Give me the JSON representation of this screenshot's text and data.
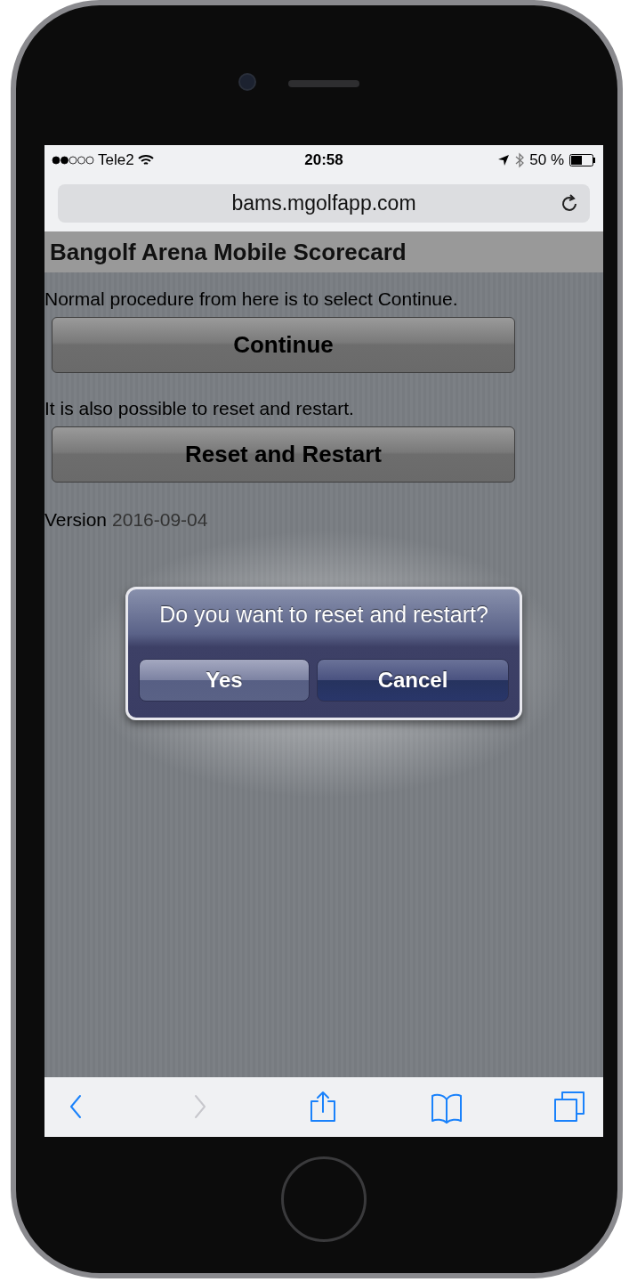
{
  "status_bar": {
    "carrier": "Tele2",
    "time": "20:58",
    "battery": "50 %"
  },
  "address_bar": {
    "url": "bams.mgolfapp.com"
  },
  "page": {
    "title": "Bangolf Arena Mobile Scorecard",
    "sections": [
      {
        "text": "Normal procedure from here is to select Continue.",
        "button": "Continue"
      },
      {
        "text": "It is also possible to reset and restart.",
        "button": "Reset and Restart"
      }
    ],
    "version_label": "Version",
    "version": "2016-09-04"
  },
  "dialog": {
    "message": "Do you want to reset and restart?",
    "buttons": [
      {
        "label": "Yes",
        "kind": "plain"
      },
      {
        "label": "Cancel",
        "kind": "default"
      }
    ]
  },
  "toolbar": [
    {
      "kind": "back",
      "disabled": false
    },
    {
      "kind": "forward",
      "disabled": true
    },
    {
      "kind": "share",
      "disabled": false
    },
    {
      "kind": "bookmarks",
      "disabled": false
    },
    {
      "kind": "tabs",
      "disabled": false
    }
  ]
}
